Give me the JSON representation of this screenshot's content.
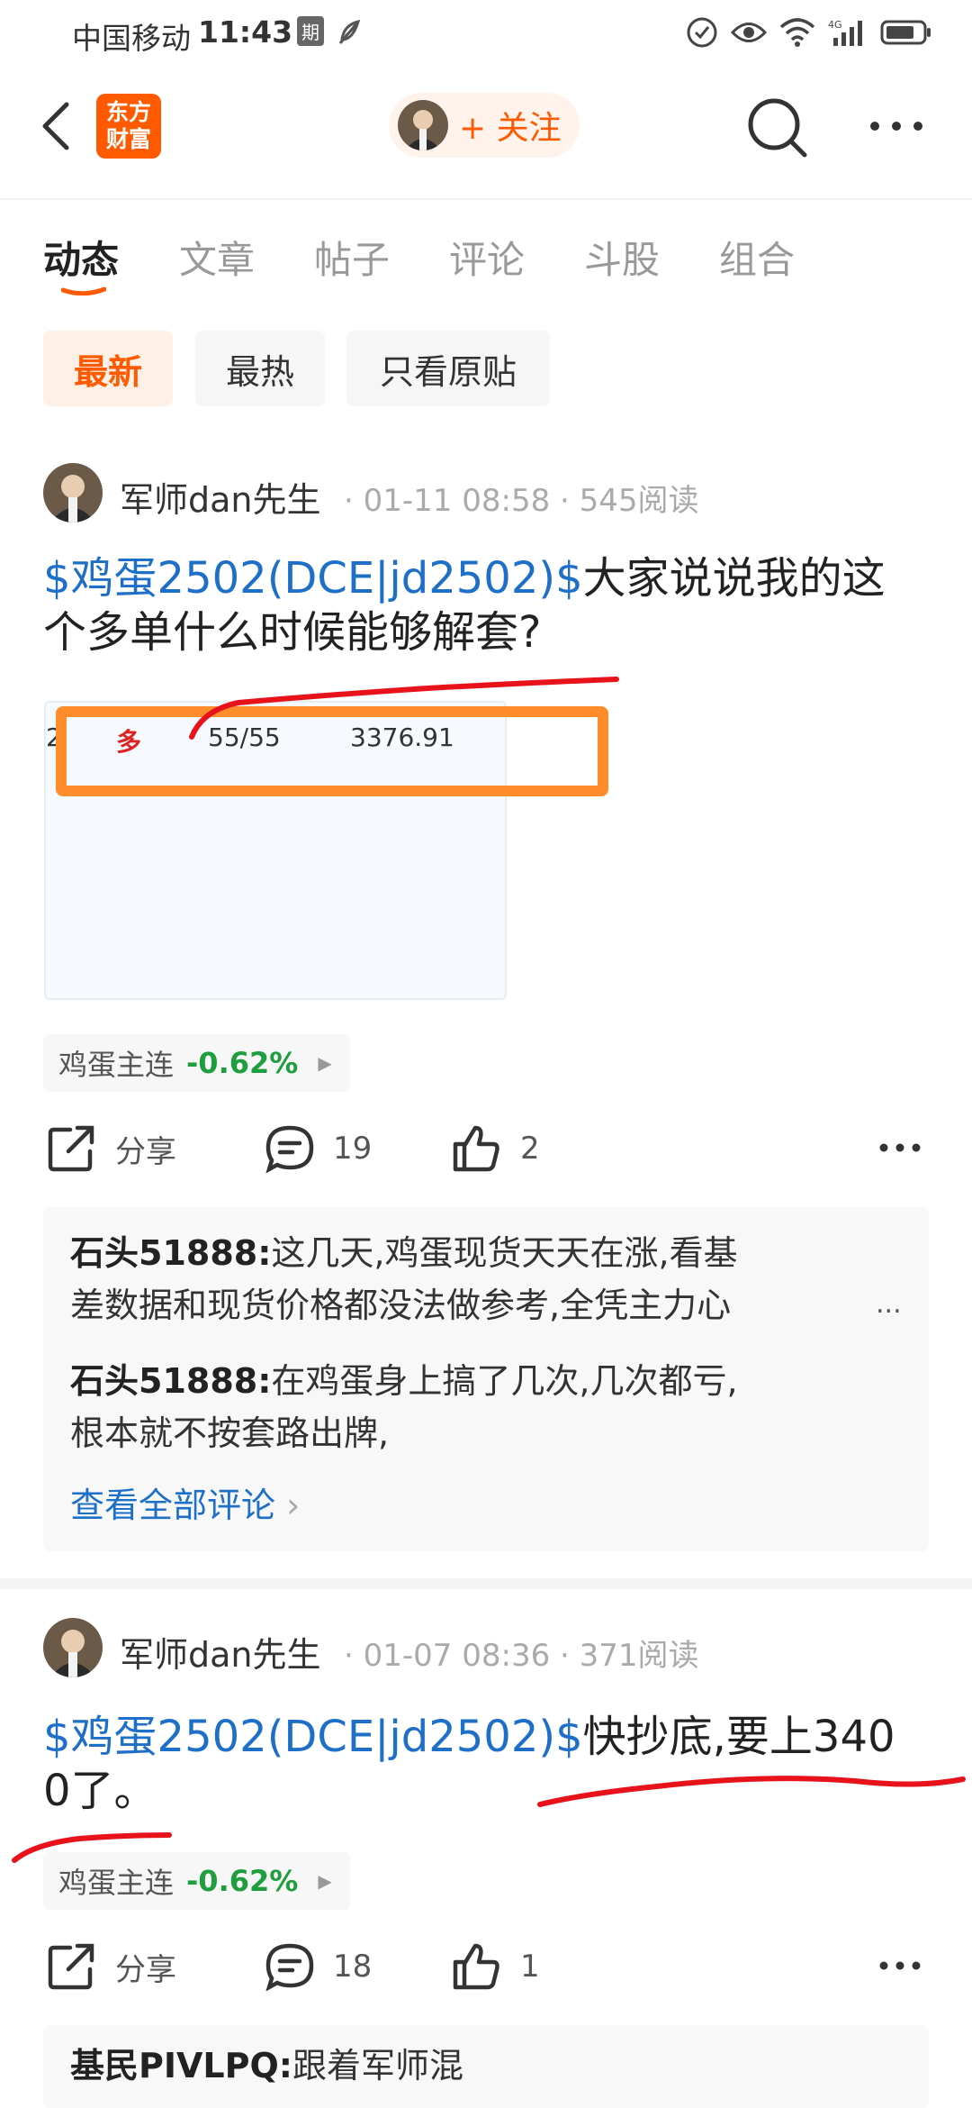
{
  "status_bar": {
    "carrier": "中国移动",
    "time": "11:43",
    "badge": "期"
  },
  "header": {
    "logo_text": "东方财富",
    "follow_label": "+ 关注"
  },
  "tabs": [
    "动态",
    "文章",
    "帖子",
    "评论",
    "斗股",
    "组合"
  ],
  "filters": [
    "最新",
    "最热",
    "只看原贴"
  ],
  "colors": {
    "accent": "#ff5a00",
    "link": "#1e6fc8",
    "down_green": "#1e9e3e",
    "annotation_red": "#e8121b",
    "highlight_orange": "#ff8c2a"
  },
  "posts": [
    {
      "author": "军师dan先生",
      "meta": "· 01-11 08:58 · 545阅读",
      "link": "$鸡蛋2502(DCE|jd2502)$",
      "text_line1": "大家说说我的这",
      "text_line2": "个多单什么时候能够解套?",
      "image": {
        "col0": "2",
        "direction": "多",
        "qty": "55/55",
        "price": "3376.91"
      },
      "quote": {
        "name": "鸡蛋主连",
        "change": "-0.62%"
      },
      "actions": {
        "share": "分享",
        "comments": "19",
        "likes": "2"
      },
      "comments": [
        {
          "user": "石头51888:",
          "line1": "这几天,鸡蛋现货天天在涨,看基",
          "line2": "差数据和现货价格都没法做参考,全凭主力心",
          "ellipsis": "..."
        },
        {
          "user": "石头51888:",
          "line1": "在鸡蛋身上搞了几次,几次都亏,",
          "line2": "根本就不按套路出牌,"
        }
      ],
      "view_all": "查看全部评论"
    },
    {
      "author": "军师dan先生",
      "meta": "· 01-07 08:36 · 371阅读",
      "link": "$鸡蛋2502(DCE|jd2502)$",
      "text_line1": "快抄底,要上340",
      "text_line2": "0了。",
      "quote": {
        "name": "鸡蛋主连",
        "change": "-0.62%"
      },
      "actions": {
        "share": "分享",
        "comments": "18",
        "likes": "1"
      },
      "comments": [
        {
          "user": "基民PIVLPQ:",
          "line1": "跟着军师混"
        }
      ]
    }
  ]
}
